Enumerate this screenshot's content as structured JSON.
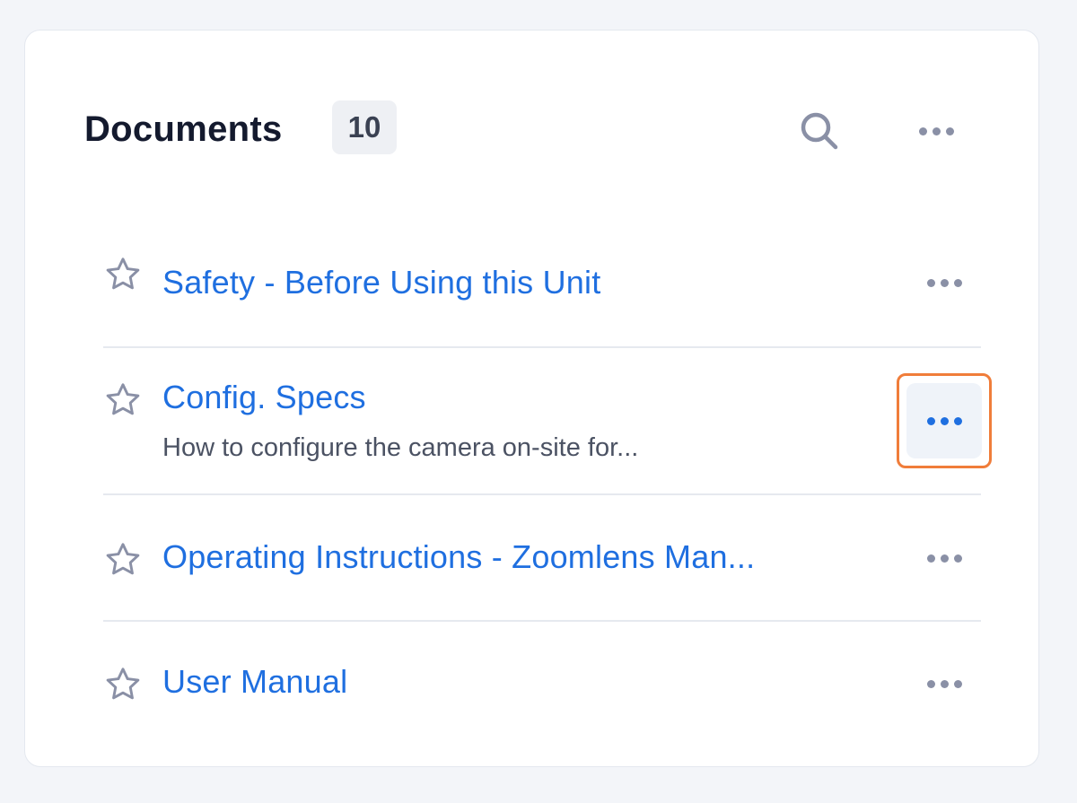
{
  "panel": {
    "title": "Documents",
    "count": "10"
  },
  "icons": {
    "search": "search-icon",
    "more": "more-horizontal-icon",
    "star": "star-outline-icon"
  },
  "colors": {
    "link": "#1f6fe0",
    "focus_ring": "#f07d3a",
    "icon_gray": "#8a90a6"
  },
  "documents": [
    {
      "title": "Safety - Before Using this Unit",
      "description": ""
    },
    {
      "title": "Config. Specs",
      "description": "How to configure the camera on-site for..."
    },
    {
      "title": "Operating Instructions - Zoomlens Man...",
      "description": ""
    },
    {
      "title": "User Manual",
      "description": ""
    }
  ]
}
